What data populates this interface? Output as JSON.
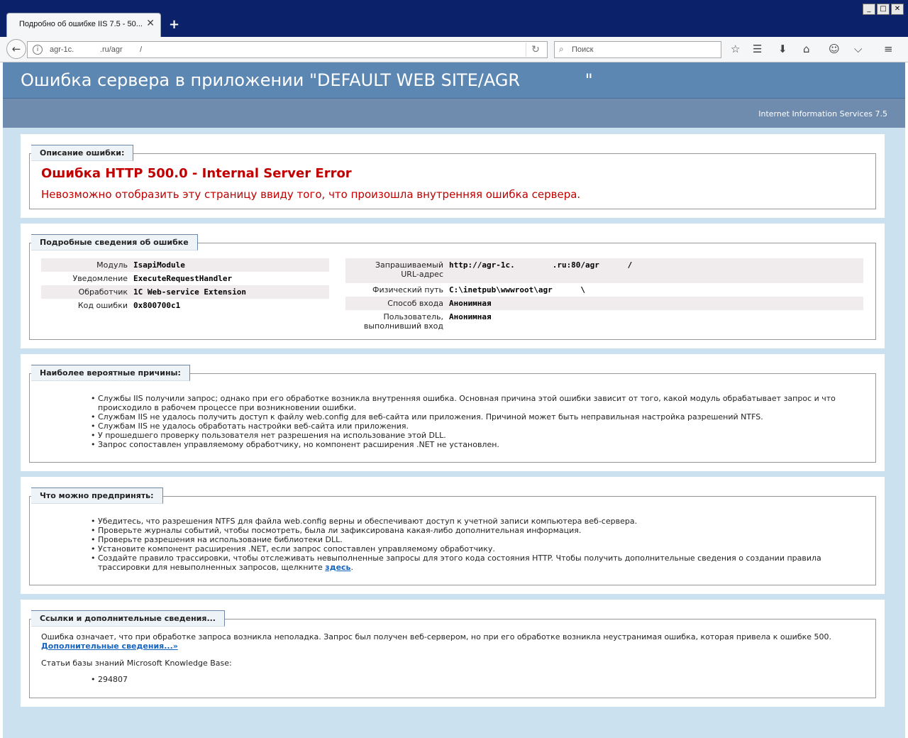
{
  "browser": {
    "tab_title": "Подробно об ошибке IIS 7.5 - 50...",
    "tab_close": "✕",
    "new_tab": "+",
    "window_buttons": [
      "_",
      "□",
      "✕"
    ],
    "url": "agr-1c.            .ru/agr        /",
    "search_placeholder": "Поиск",
    "icons": [
      "back-icon",
      "info-icon",
      "reload-icon",
      "search-icon",
      "bookmark-star-icon",
      "reading-list-icon",
      "download-icon",
      "home-icon",
      "hello-icon",
      "pocket-icon",
      "menu-icon"
    ]
  },
  "header": {
    "title": "Ошибка сервера в приложении \"DEFAULT WEB SITE/AGR            \"",
    "server": "Internet Information Services 7.5"
  },
  "description": {
    "legend": "Описание ошибки:",
    "error_title": "Ошибка HTTP 500.0 - Internal Server Error",
    "error_message": "Невозможно отобразить эту страницу ввиду того, что произошла внутренняя ошибка сервера."
  },
  "details": {
    "legend": "Подробные сведения об ошибке",
    "left": [
      {
        "key": "Модуль",
        "value": "IsapiModule"
      },
      {
        "key": "Уведомление",
        "value": "ExecuteRequestHandler"
      },
      {
        "key": "Обработчик",
        "value": "1C Web-service Extension"
      },
      {
        "key": "Код ошибки",
        "value": "0x800700c1"
      }
    ],
    "right": [
      {
        "key_line1": "Запрашиваемый",
        "key_line2": "URL-адрес",
        "value": "http://agr-1c.        .ru:80/agr      /"
      },
      {
        "key_line1": "Физический путь",
        "key_line2": "",
        "value": "C:\\inetpub\\wwwroot\\agr      \\"
      },
      {
        "key_line1": "Способ входа",
        "key_line2": "",
        "value": "Анонимная"
      },
      {
        "key_line1": "Пользователь,",
        "key_line2": "выполнивший вход",
        "value": "Анонимная"
      }
    ]
  },
  "causes": {
    "legend": "Наиболее вероятные причины:",
    "items": [
      "Службы IIS получили запрос; однако при его обработке возникла внутренняя ошибка. Основная причина этой ошибки зависит от того, какой модуль обрабатывает запрос и что происходило в рабочем процессе при возникновении ошибки.",
      "Службам IIS не удалось получить доступ к файлу web.config для веб-сайта или приложения. Причиной может быть неправильная настройка разрешений NTFS.",
      "Службам IIS не удалось обработать настройки веб-сайта или приложения.",
      "У прошедшего проверку пользователя нет разрешения на использование этой DLL.",
      "Запрос сопоставлен управляемому обработчику, но компонент расширения .NET не установлен."
    ]
  },
  "actions": {
    "legend": "Что можно предпринять:",
    "items": [
      "Убедитесь, что разрешения NTFS для файла web.config верны и обеспечивают доступ к учетной записи компьютера веб-сервера.",
      "Проверьте журналы событий, чтобы посмотреть, была ли зафиксирована какая-либо дополнительная информация.",
      "Проверьте разрешения на использование библиотеки DLL.",
      "Установите компонент расширения .NET, если запрос сопоставлен управляемому обработчику."
    ],
    "last_item_text": "Создайте правило трассировки, чтобы отслеживать невыполненные запросы для этого кода состояния HTTP. Чтобы получить дополнительные сведения о создании правила трассировки для невыполненных запросов, щелкните",
    "last_item_link": "здесь",
    "last_item_end": "."
  },
  "links": {
    "legend": "Ссылки и дополнительные сведения...",
    "text": "Ошибка означает, что при обработке запроса возникла неполадка. Запрос был получен веб-сервером, но при его обработке возникла неустранимая ошибка, которая привела к ошибке 500.",
    "more_link": "Дополнительные сведения...»",
    "kb_label": "Статьи базы знаний Microsoft Knowledge Base:",
    "kb_items": [
      "294807"
    ]
  }
}
